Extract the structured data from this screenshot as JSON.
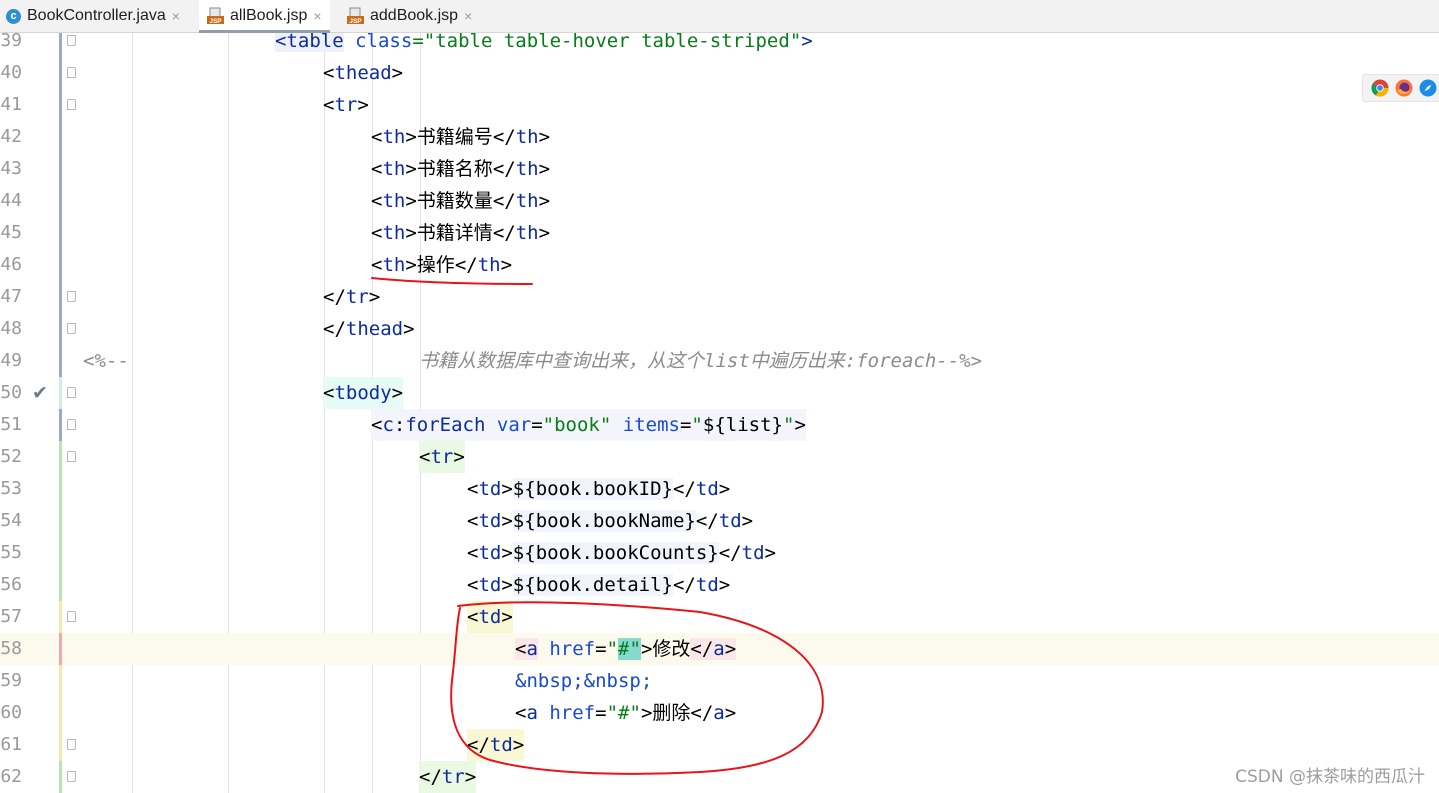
{
  "tabs": [
    {
      "label": "BookController.java",
      "icon": "java-class-icon",
      "active": false
    },
    {
      "label": "allBook.jsp",
      "icon": "jsp-file-icon",
      "active": true
    },
    {
      "label": "addBook.jsp",
      "icon": "jsp-file-icon",
      "active": false
    }
  ],
  "tab_close_glyph": "×",
  "jsp_icon_text": "JSP",
  "class_icon_text": "c",
  "line_numbers": [
    "39",
    "40",
    "41",
    "42",
    "43",
    "44",
    "45",
    "46",
    "47",
    "48",
    "49",
    "50",
    "51",
    "52",
    "53",
    "54",
    "55",
    "56",
    "57",
    "58",
    "59",
    "60",
    "61",
    "62"
  ],
  "code": {
    "l39_open": "<",
    "l39_tag": "table",
    "l39_attr": "class",
    "l39_eq": "=",
    "l39_val": "\"table table-hover table-striped\"",
    "l39_close": ">",
    "l40": "thead",
    "l41": "tr",
    "th1": "书籍编号",
    "th2": "书籍名称",
    "th3": "书籍数量",
    "th4": "书籍详情",
    "th5": "操作",
    "th_tag": "th",
    "l47": "tr",
    "l48": "thead",
    "l49_open": "<%--",
    "l49_text": "书籍从数据库中查询出来，从这个list中遍历出来:foreach--%>",
    "l50": "tbody",
    "l51_prefix": "c",
    "l51_tag": "forEach",
    "l51_attr1": "var",
    "l51_val1": "\"book\"",
    "l51_attr2": "items",
    "l51_val2_a": "\"",
    "l51_val2_el_open": "${",
    "l51_val2_el": "list",
    "l51_val2_el_close": "}",
    "l51_val2_b": "\"",
    "l52": "tr",
    "td_tag": "td",
    "el1": "book.bookID",
    "el2": "book.bookName",
    "el3": "book.bookCounts",
    "el4": "book.detail",
    "el_open": "${",
    "el_close": "}",
    "a_tag": "a",
    "href_attr": "href",
    "href_val_q": "\"",
    "href_val": "#",
    "edit_label": "修改",
    "nbsp": "&nbsp;&nbsp;",
    "delete_label": "删除",
    "l62": "tr"
  },
  "browser_icons": [
    "chrome-icon",
    "firefox-icon",
    "safari-icon"
  ],
  "watermark": "CSDN @抹茶味的西瓜汁",
  "colors": {
    "tag": "#0b2c9c",
    "attr": "#174ad4",
    "string": "#067d17",
    "comment": "#8c8c8c",
    "annotation": "#e8141a"
  }
}
